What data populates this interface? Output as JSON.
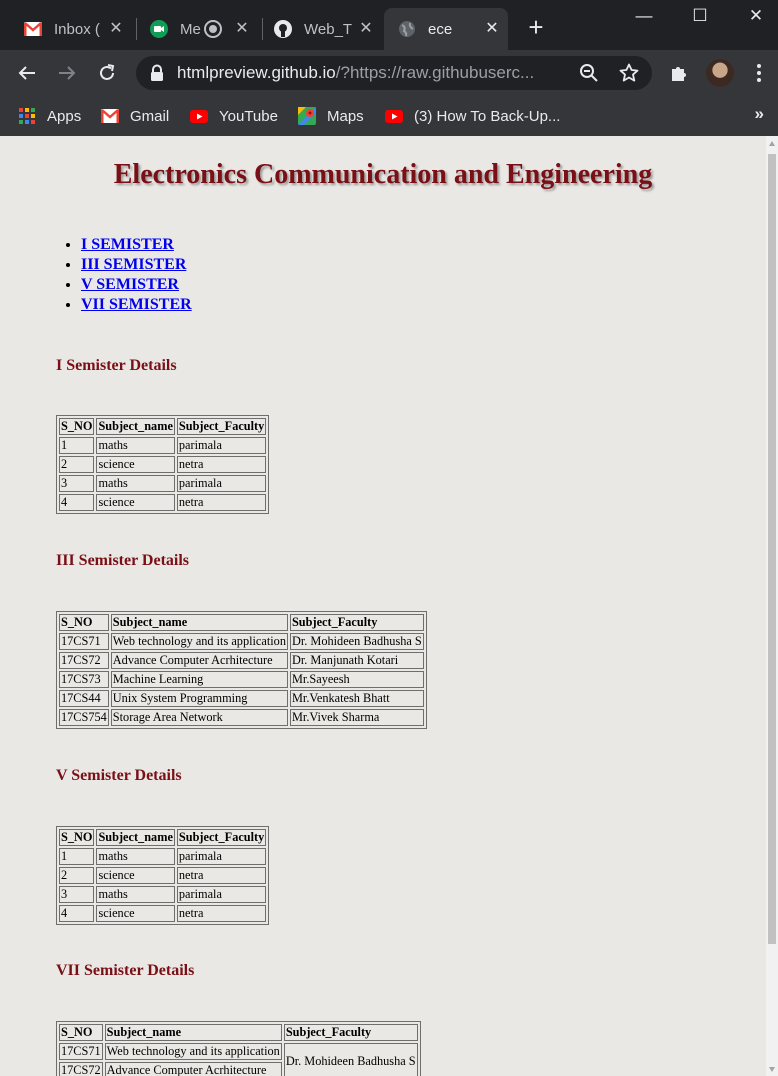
{
  "browser": {
    "tabs": [
      {
        "title": "Inbox (",
        "icon": "gmail-icon"
      },
      {
        "title": "Me",
        "icon": "meet-icon"
      },
      {
        "title": "Web_T",
        "icon": "github-icon"
      },
      {
        "title": "ece",
        "icon": "globe-icon",
        "active": true
      }
    ],
    "address": {
      "host": "htmlpreview.github.io",
      "path": "/?https://raw.githubuserc..."
    },
    "bookmarks": [
      {
        "label": "Apps",
        "icon": "apps-grid-icon"
      },
      {
        "label": "Gmail",
        "icon": "gmail-icon"
      },
      {
        "label": "YouTube",
        "icon": "youtube-icon"
      },
      {
        "label": "Maps",
        "icon": "maps-icon"
      },
      {
        "label": "(3) How To Back-Up...",
        "icon": "youtube-icon"
      }
    ],
    "more_bookmarks": "»"
  },
  "page": {
    "title": "Electronics Communication and Engineering",
    "nav": [
      "I SEMISTER",
      "III SEMISTER",
      "V SEMISTER",
      "VII SEMISTER"
    ],
    "columns": [
      "S_NO",
      "Subject_name",
      "Subject_Faculty"
    ],
    "sections": [
      {
        "heading": "I Semister Details",
        "rows": [
          [
            "1",
            "maths",
            "parimala"
          ],
          [
            "2",
            "science",
            "netra"
          ],
          [
            "3",
            "maths",
            "parimala"
          ],
          [
            "4",
            "science",
            "netra"
          ]
        ]
      },
      {
        "heading": "III Semister Details",
        "rows": [
          [
            "17CS71",
            "Web technology and its application",
            "Dr. Mohideen Badhusha S"
          ],
          [
            "17CS72",
            "Advance Computer Acrhitecture",
            "Dr. Manjunath Kotari"
          ],
          [
            "17CS73",
            "Machine Learning",
            "Mr.Sayeesh"
          ],
          [
            "17CS44",
            "Unix System Programming",
            "Mr.Venkatesh Bhatt"
          ],
          [
            "17CS754",
            "Storage Area Network",
            "Mr.Vivek Sharma"
          ]
        ]
      },
      {
        "heading": "V Semister Details",
        "rows": [
          [
            "1",
            "maths",
            "parimala"
          ],
          [
            "2",
            "science",
            "netra"
          ],
          [
            "3",
            "maths",
            "parimala"
          ],
          [
            "4",
            "science",
            "netra"
          ]
        ]
      },
      {
        "heading": "VII Semister Details",
        "rows": [
          [
            "17CS71",
            "Web technology and its application",
            "Dr. Mohideen Badhusha S"
          ],
          [
            "17CS72",
            "Advance Computer Acrhitecture",
            null
          ]
        ]
      }
    ]
  }
}
